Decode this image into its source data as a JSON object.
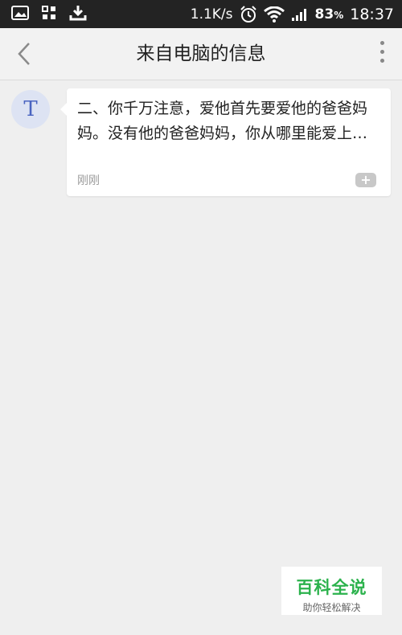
{
  "status_bar": {
    "speed": "1.1K/s",
    "battery": "83",
    "battery_unit": "%",
    "time": "18:37",
    "icons": [
      "gallery-icon",
      "apps-icon",
      "download-icon",
      "alarm-icon",
      "wifi-icon",
      "signal-icon"
    ]
  },
  "header": {
    "title": "来自电脑的信息",
    "back_icon": "chevron-left-icon",
    "more_icon": "more-vertical-icon"
  },
  "message": {
    "avatar_letter": "T",
    "text": "二、你千万注意，爱他首先要爱他的爸爸妈妈。没有他的爸爸妈妈，你从哪里能爱上他呢？他怎么会出现让你去爱呢？不…",
    "time": "刚刚",
    "expand_label": "+"
  },
  "watermark": {
    "title": "百科全说",
    "subtitle": "助你轻松解决"
  },
  "colors": {
    "status_bar_bg": "#232323",
    "background": "#efefef",
    "avatar_bg": "#dde3f3",
    "avatar_fg": "#4a64c0",
    "watermark_green": "#2bb24c"
  }
}
